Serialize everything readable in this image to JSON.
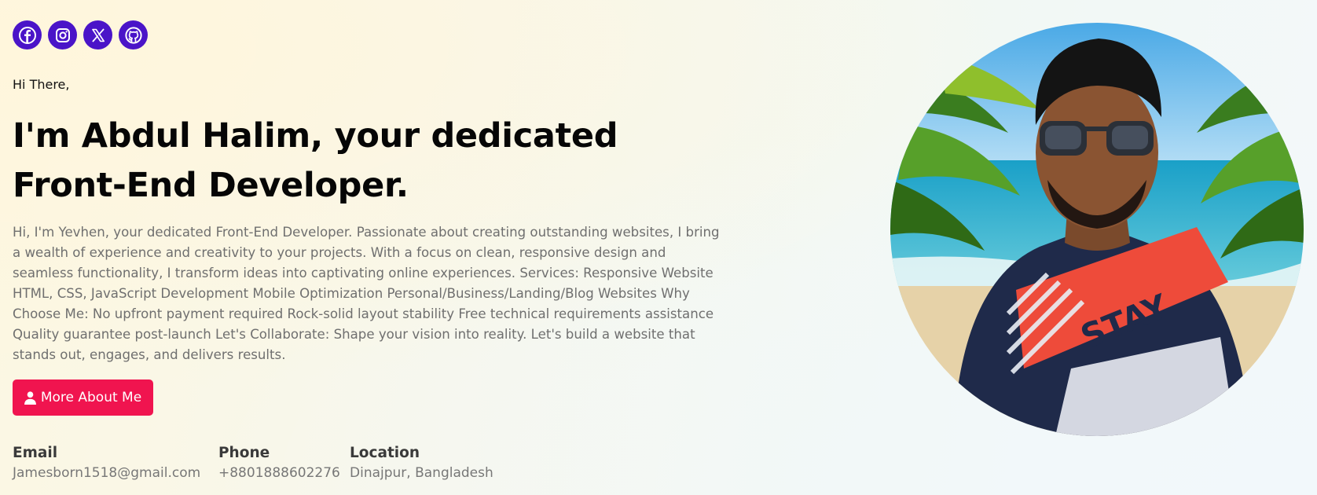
{
  "social": [
    {
      "name": "facebook-icon"
    },
    {
      "name": "instagram-icon"
    },
    {
      "name": "x-icon"
    },
    {
      "name": "github-icon"
    }
  ],
  "hero": {
    "greeting": "Hi There,",
    "headline": "I'm Abdul Halim, your dedicated Front-End Developer.",
    "bio": "Hi, I'm Yevhen, your dedicated Front-End Developer. Passionate about creating outstanding websites, I bring a wealth of experience and creativity to your projects. With a focus on clean, responsive design and seamless functionality, I transform ideas into captivating online experiences. Services: Responsive Website HTML, CSS, JavaScript Development Mobile Optimization Personal/Business/Landing/Blog Websites Why Choose Me: No upfront payment required Rock-solid layout stability Free technical requirements assistance Quality guarantee post-launch Let's Collaborate: Shape your vision into reality. Let's build a website that stands out, engages, and delivers results.",
    "button_label": "More About Me",
    "button_icon": "user-icon"
  },
  "contact": {
    "email_label": "Email",
    "email_value": "Jamesborn1518@gmail.com",
    "phone_label": "Phone",
    "phone_value": "+8801888602276",
    "location_label": "Location",
    "location_value": "Dinajpur, Bangladesh"
  },
  "portrait": {
    "shirt_text": "STAY"
  },
  "colors": {
    "social_bg": "#4a14c8",
    "button_bg": "#f0144f",
    "heading": "#060606",
    "body_text": "#6f6f6f"
  }
}
